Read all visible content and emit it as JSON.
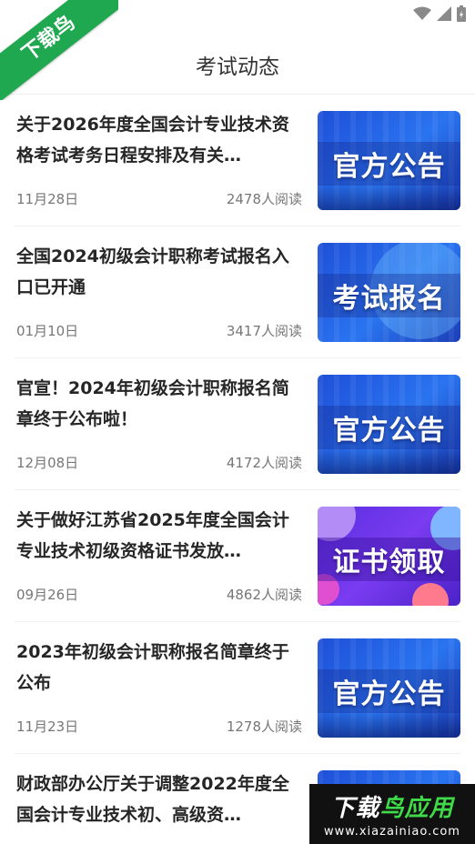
{
  "status_bar": {
    "icons": [
      "wifi-icon",
      "signal-icon",
      "battery-icon"
    ]
  },
  "ribbon": {
    "text": "下载鸟",
    "color": "#1fa84f"
  },
  "header": {
    "title": "考试动态",
    "back_icon": "back-arrow-icon"
  },
  "articles": [
    {
      "title": "关于2026年度全国会计专业技术资格考试考务日程安排及有关…",
      "date": "11月28日",
      "reads": "2478人阅读",
      "thumb_label": "官方公告",
      "thumb_style": "blue"
    },
    {
      "title": "全国2024初级会计职称考试报名入口已开通",
      "date": "01月10日",
      "reads": "3417人阅读",
      "thumb_label": "考试报名",
      "thumb_style": "blue"
    },
    {
      "title": "官宣！2024年初级会计职称报名简章终于公布啦！",
      "date": "12月08日",
      "reads": "4172人阅读",
      "thumb_label": "官方公告",
      "thumb_style": "blue"
    },
    {
      "title": "关于做好江苏省2025年度全国会计专业技术初级资格证书发放…",
      "date": "09月26日",
      "reads": "4862人阅读",
      "thumb_label": "证书领取",
      "thumb_style": "purple"
    },
    {
      "title": "2023年初级会计职称报名简章终于公布",
      "date": "11月23日",
      "reads": "1278人阅读",
      "thumb_label": "官方公告",
      "thumb_style": "blue"
    },
    {
      "title": "财政部办公厅关于调整2022年度全国会计专业技术初、高级资…",
      "date": "",
      "reads": "",
      "thumb_label": "",
      "thumb_style": "blue"
    }
  ],
  "watermark": {
    "main_prefix": "下载",
    "main_suffix": "鸟应用",
    "url": "www.xiazainiao.com"
  }
}
